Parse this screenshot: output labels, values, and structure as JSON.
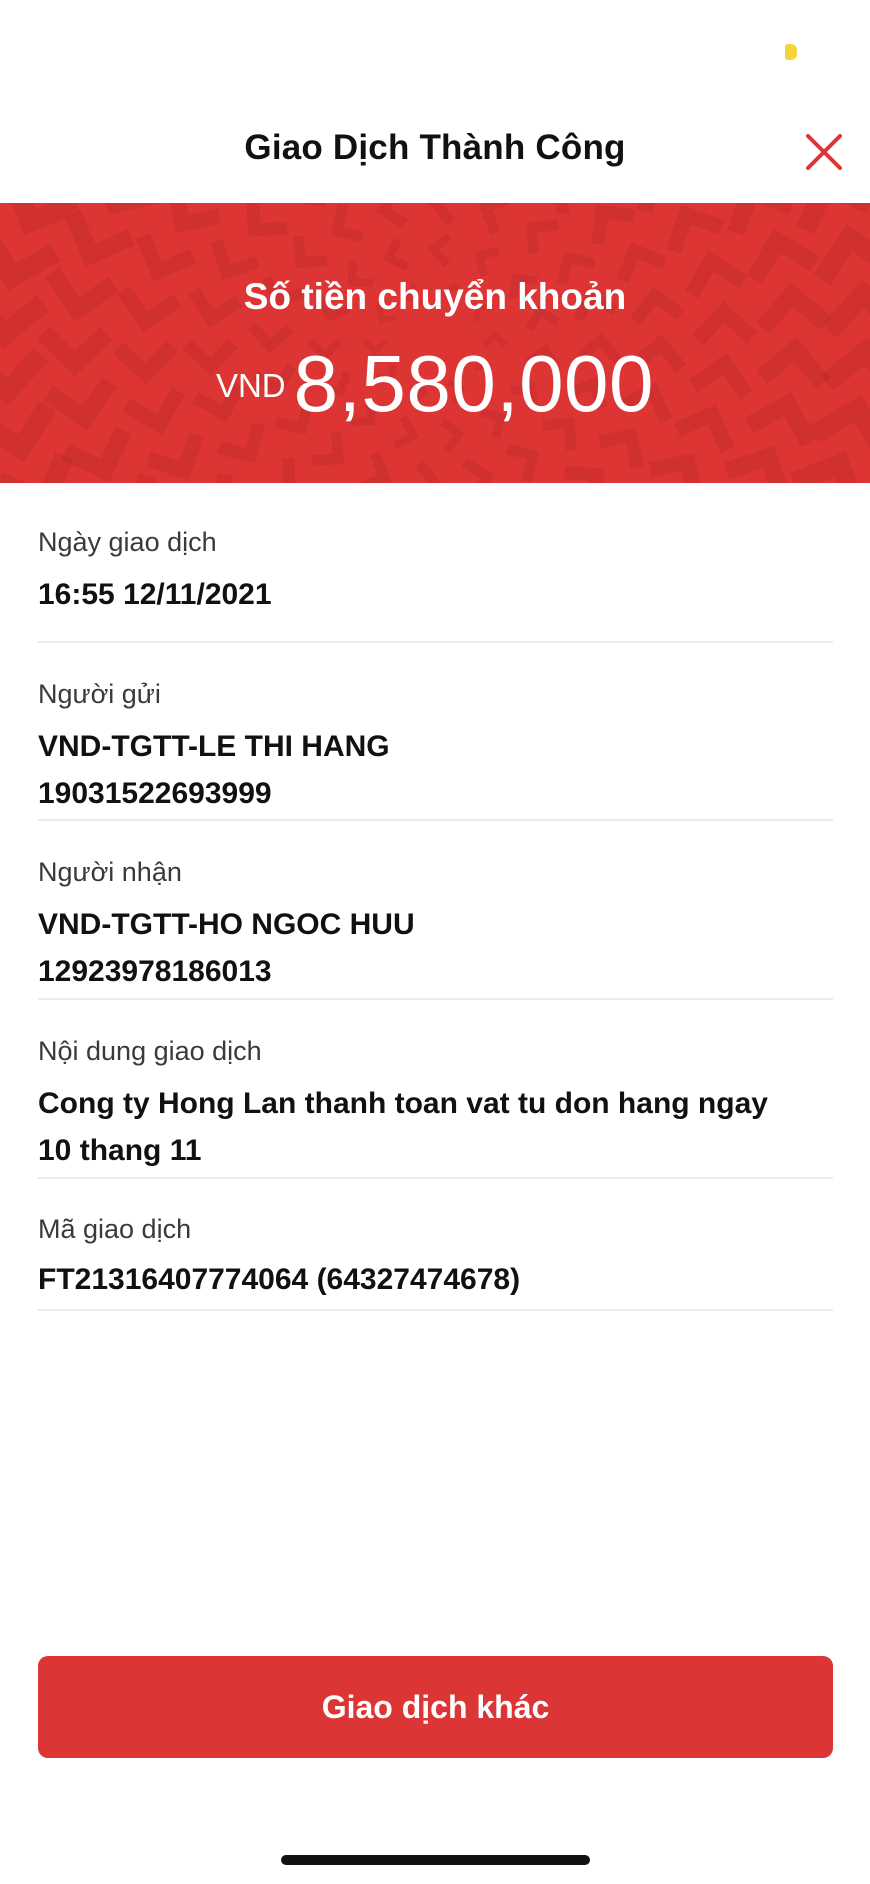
{
  "header": {
    "title": "Giao Dịch Thành Công"
  },
  "banner": {
    "label": "Số tiền chuyển khoản",
    "currency": "VND",
    "amount": "8,580,000"
  },
  "details": [
    {
      "label": "Ngày giao dịch",
      "value": "16:55 12/11/2021"
    },
    {
      "label": "Người gửi",
      "value": "VND-TGTT-LE THI HANG\n19031522693999"
    },
    {
      "label": "Người nhận",
      "value": "VND-TGTT-HO NGOC HUU\n12923978186013"
    },
    {
      "label": "Nội dung giao dịch",
      "value": "Cong ty Hong Lan thanh toan vat tu don hang ngay\n10 thang 11"
    },
    {
      "label": "Mã giao dịch",
      "value": "FT21316407774064 (64327474678)"
    }
  ],
  "action_button": {
    "label": "Giao dịch khác"
  },
  "colors": {
    "accent": "#db3535",
    "banner_bg": "#dd3434",
    "status_indicator": "#f6d437"
  },
  "icons": {
    "close": "close-icon"
  }
}
